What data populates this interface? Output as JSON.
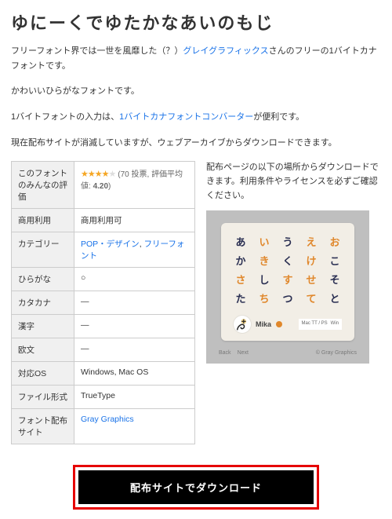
{
  "title": "ゆにーくでゆたかなあいのもじ",
  "intro": {
    "pre": "フリーフォント界では一世を風靡した（？）",
    "link": "グレイグラフィックス",
    "post": "さんのフリーの1バイトカナフォントです。"
  },
  "para1": "かわいいひらがなフォントです。",
  "para2": {
    "pre": "1バイトフォントの入力は、",
    "link": "1バイトカナフォントコンバーター",
    "post": "が便利です。"
  },
  "para3": "現在配布サイトが消滅していますが、ウェブアーカイブからダウンロードできます。",
  "right_note": "配布ページの以下の場所からダウンロードできます。利用条件やライセンスを必ずご確認ください。",
  "table": {
    "rows": [
      {
        "label": "このフォントのみんなの評価",
        "rating": {
          "votes": "70 投票",
          "avg_label": "評価平均値",
          "avg": "4.20"
        }
      },
      {
        "label": "商用利用",
        "value": "商用利用可"
      },
      {
        "label": "カテゴリー",
        "links": [
          "POP・デザイン",
          "フリーフォント"
        ]
      },
      {
        "label": "ひらがな",
        "value": "○"
      },
      {
        "label": "カタカナ",
        "value": "―"
      },
      {
        "label": "漢字",
        "value": "―"
      },
      {
        "label": "欧文",
        "value": "―"
      },
      {
        "label": "対応OS",
        "value": "Windows, Mac OS"
      },
      {
        "label": "ファイル形式",
        "value": "TrueType"
      },
      {
        "label": "フォント配布サイト",
        "link": "Gray Graphics"
      }
    ]
  },
  "preview": {
    "glyphs": [
      "あ",
      "い",
      "う",
      "え",
      "お",
      "か",
      "き",
      "く",
      "け",
      "こ",
      "さ",
      "し",
      "す",
      "せ",
      "そ",
      "た",
      "ち",
      "つ",
      "て",
      "と"
    ],
    "user": "Mika",
    "micro1": "Mac TT / PS",
    "micro2": "Win",
    "back": "Back",
    "next": "Next",
    "copyright": "© Gray Graphics"
  },
  "download_label": "配布サイトでダウンロード"
}
